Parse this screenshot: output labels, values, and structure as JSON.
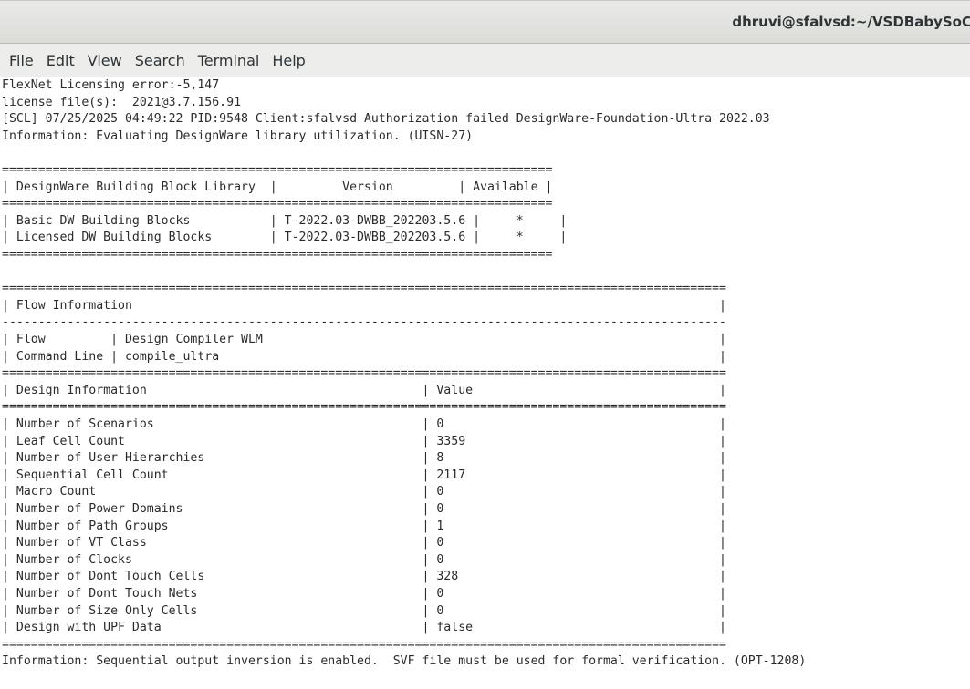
{
  "window": {
    "title": "dhruvi@sfalvsd:~/VSDBabySoC"
  },
  "menubar": {
    "items": [
      {
        "label": "File"
      },
      {
        "label": "Edit"
      },
      {
        "label": "View"
      },
      {
        "label": "Search"
      },
      {
        "label": "Terminal"
      },
      {
        "label": "Help"
      }
    ]
  },
  "terminal": {
    "lines": [
      "FlexNet Licensing error:-5,147",
      "license file(s):  2021@3.7.156.91",
      "[SCL] 07/25/2025 04:49:22 PID:9548 Client:sfalvsd Authorization failed DesignWare-Foundation-Ultra 2022.03",
      "Information: Evaluating DesignWare library utilization. (UISN-27)",
      "",
      "============================================================================",
      "| DesignWare Building Block Library  |         Version         | Available |",
      "============================================================================",
      "| Basic DW Building Blocks           | T-2022.03-DWBB_202203.5.6 |     *     |",
      "| Licensed DW Building Blocks        | T-2022.03-DWBB_202203.5.6 |     *     |",
      "============================================================================",
      "",
      "====================================================================================================",
      "| Flow Information                                                                                 |",
      "----------------------------------------------------------------------------------------------------",
      "| Flow         | Design Compiler WLM                                                               |",
      "| Command Line | compile_ultra                                                                     |",
      "====================================================================================================",
      "| Design Information                                      | Value                                  |",
      "====================================================================================================",
      "| Number of Scenarios                                     | 0                                      |",
      "| Leaf Cell Count                                         | 3359                                   |",
      "| Number of User Hierarchies                              | 8                                      |",
      "| Sequential Cell Count                                   | 2117                                   |",
      "| Macro Count                                             | 0                                      |",
      "| Number of Power Domains                                 | 0                                      |",
      "| Number of Path Groups                                   | 1                                      |",
      "| Number of VT Class                                      | 0                                      |",
      "| Number of Clocks                                        | 0                                      |",
      "| Number of Dont Touch Cells                              | 328                                    |",
      "| Number of Dont Touch Nets                               | 0                                      |",
      "| Number of Size Only Cells                               | 0                                      |",
      "| Design with UPF Data                                    | false                                  |",
      "====================================================================================================",
      "Information: Sequential output inversion is enabled.  SVF file must be used for formal verification. (OPT-1208)"
    ]
  }
}
